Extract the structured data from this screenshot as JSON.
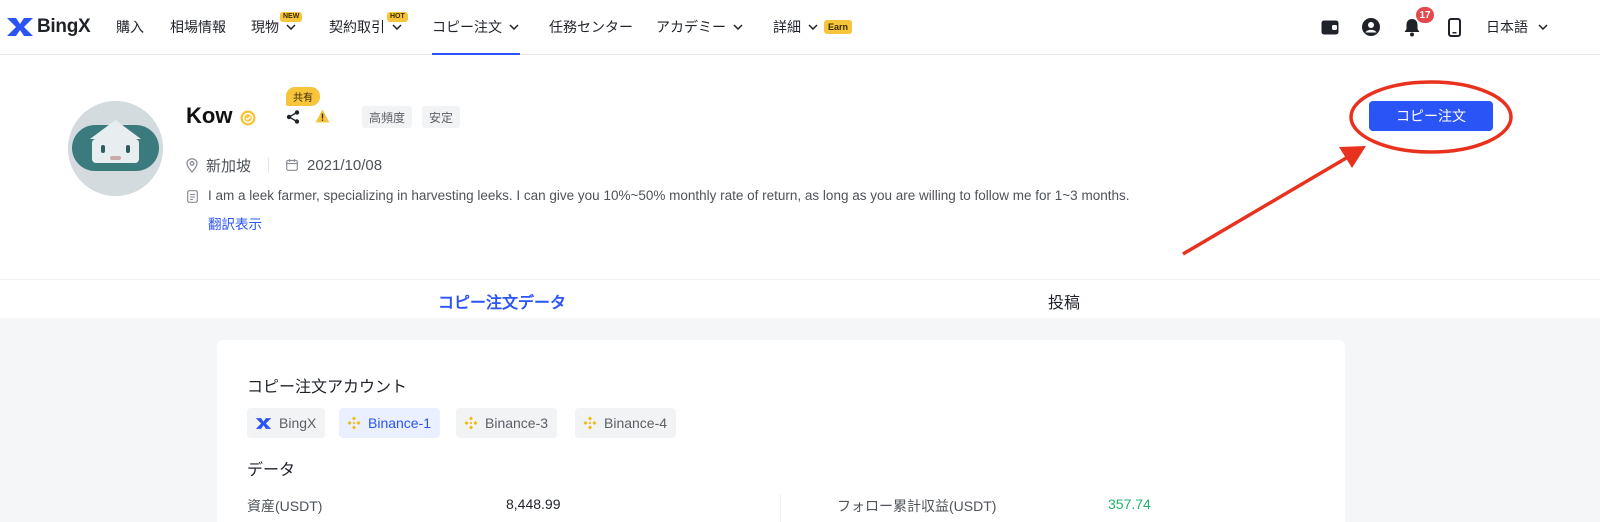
{
  "nav": {
    "brand": "BingX",
    "items": [
      {
        "label": "購入"
      },
      {
        "label": "相場情報"
      },
      {
        "label": "現物",
        "badge": "NEW"
      },
      {
        "label": "契約取引",
        "badge": "HOT"
      },
      {
        "label": "コピー注文"
      },
      {
        "label": "任務センター"
      },
      {
        "label": "アカデミー"
      },
      {
        "label": "詳細",
        "badge": "Earn"
      }
    ],
    "notification_count": "17",
    "language": "日本語"
  },
  "profile": {
    "name": "Kow",
    "shared_tag": "共有",
    "tags": [
      "高頻度",
      "安定"
    ],
    "location": "新加坡",
    "join_date": "2021/10/08",
    "bio": "I am a leek farmer, specializing in harvesting leeks. I can give you 10%~50% monthly rate of return, as long as you are willing to follow me for 1~3 months.",
    "translate_link": "翻訳表示",
    "copy_button": "コピー注文"
  },
  "tabs": [
    {
      "label": "コピー注文データ",
      "active": true
    },
    {
      "label": "投稿",
      "active": false
    }
  ],
  "accounts": {
    "title": "コピー注文アカウント",
    "items": [
      {
        "label": "BingX",
        "active": false
      },
      {
        "label": "Binance-1",
        "active": true
      },
      {
        "label": "Binance-3",
        "active": false
      },
      {
        "label": "Binance-4",
        "active": false
      }
    ]
  },
  "data_section": {
    "title": "データ",
    "rows": [
      {
        "label": "資産(USDT)",
        "value": "8,448.99"
      },
      {
        "label": "フォロー累計収益(USDT)",
        "value": "357.74"
      }
    ]
  },
  "colors": {
    "accent": "#2a54f5",
    "badge": "#f7c53b",
    "positive": "#20b26c",
    "annotation": "#e8321e"
  }
}
